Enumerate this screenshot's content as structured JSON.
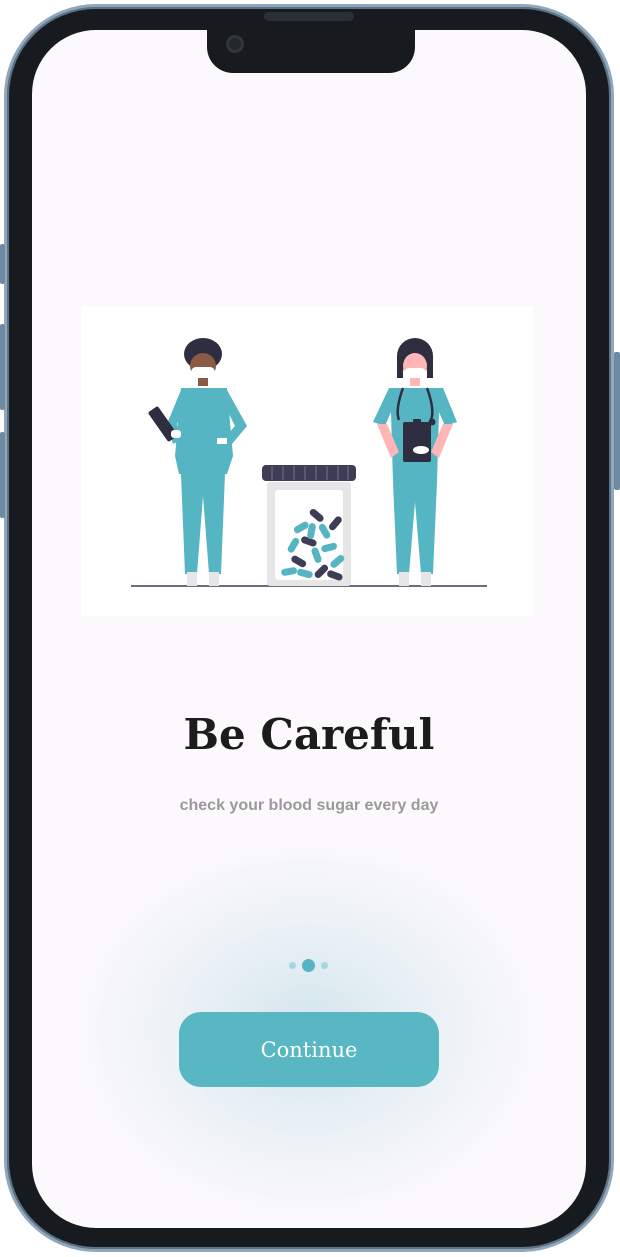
{
  "onboarding": {
    "headline": "Be Careful",
    "subtitle": "check your blood sugar every day",
    "continue_label": "Continue",
    "page_indicator": {
      "total": 3,
      "current": 2
    }
  },
  "icons": {
    "illustration": "doctors-with-pill-jar-illustration",
    "camera": "front-camera-icon"
  },
  "colors": {
    "accent": "#58b7c3",
    "accent_light": "#a6d6df",
    "scrub": "#56b5c2",
    "dark": "#2f2e41",
    "skin_dark": "#a0616a",
    "skin_light": "#ffb6b6",
    "headline": "#1c1c1c",
    "subtitle": "#9a9a9a",
    "background": "#fcf9fc"
  }
}
